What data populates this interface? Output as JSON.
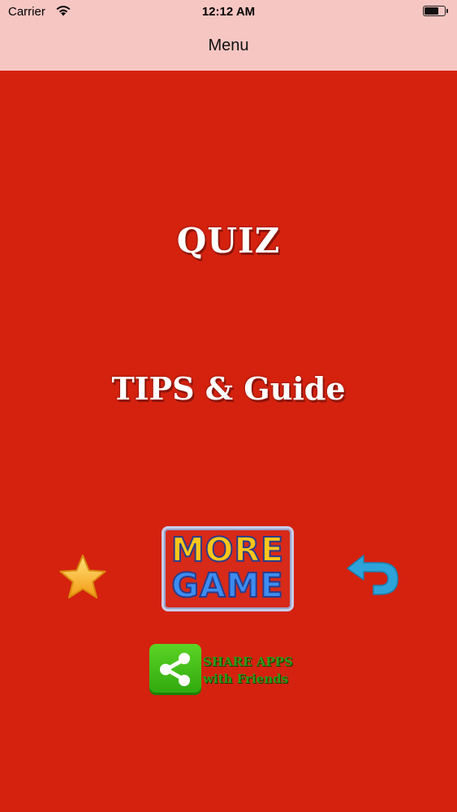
{
  "status_bar": {
    "carrier": "Carrier",
    "time": "12:12 AM",
    "battery_level": 0.75
  },
  "nav": {
    "title": "Menu"
  },
  "menu": {
    "quiz_label": "QUIZ",
    "tips_label": "TIPS & Guide"
  },
  "buttons": {
    "rate_icon": "star-icon",
    "more_game_line1": "MORE",
    "more_game_line2": "GAME",
    "back_icon": "back-arrow-icon",
    "share_icon": "share-icon",
    "share_line1": "SHARE APPS",
    "share_line2": "with Friends"
  },
  "colors": {
    "background": "#D4220F",
    "nav_bar": "#F6C6C3",
    "star": "#F7B51E",
    "back_arrow": "#2EA3D9",
    "share_green": "#3FBF18"
  }
}
